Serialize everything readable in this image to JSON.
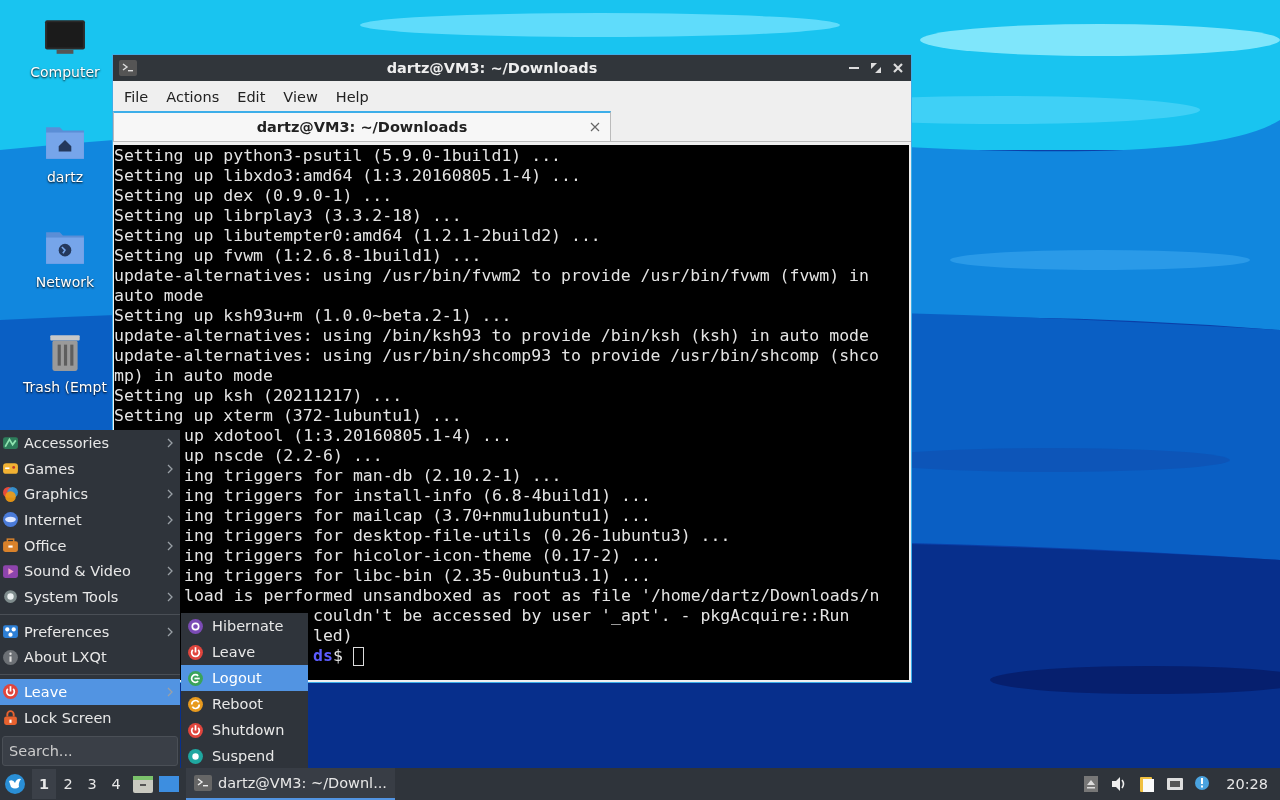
{
  "desktop_icons": [
    {
      "label": "Computer"
    },
    {
      "label": "dartz"
    },
    {
      "label": "Network"
    },
    {
      "label": "Trash (Empt"
    }
  ],
  "window": {
    "title": "dartz@VM3: ~/Downloads",
    "menu": [
      "File",
      "Actions",
      "Edit",
      "View",
      "Help"
    ],
    "tabs": [
      {
        "label": "dartz@VM3: ~/Downloads",
        "selected": true
      }
    ],
    "terminal": {
      "lines": [
        {
          "text": "Setting up python3-psutil (5.9.0-1build1) ...",
          "kind": "plain"
        },
        {
          "text": "Setting up libxdo3:amd64 (1:3.20160805.1-4) ...",
          "kind": "plain"
        },
        {
          "text": "Setting up dex (0.9.0-1) ...",
          "kind": "plain"
        },
        {
          "text": "Setting up librplay3 (3.3.2-18) ...",
          "kind": "plain"
        },
        {
          "text": "Setting up libutempter0:amd64 (1.2.1-2build2) ...",
          "kind": "plain"
        },
        {
          "text": "Setting up fvwm (1:2.6.8-1build1) ...",
          "kind": "plain"
        },
        {
          "text": "update-alternatives: using /usr/bin/fvwm2 to provide /usr/bin/fvwm (fvwm) in",
          "kind": "plain"
        },
        {
          "text": "auto mode",
          "kind": "plain"
        },
        {
          "text": "Setting up ksh93u+m (1.0.0~beta.2-1) ...",
          "kind": "plain"
        },
        {
          "text": "update-alternatives: using /bin/ksh93 to provide /bin/ksh (ksh) in auto mode",
          "kind": "plain"
        },
        {
          "text": "update-alternatives: using /usr/bin/shcomp93 to provide /usr/bin/shcomp (shco",
          "kind": "plain"
        },
        {
          "text": "mp) in auto mode",
          "kind": "plain"
        },
        {
          "text": "Setting up ksh (20211217) ...",
          "kind": "plain"
        },
        {
          "text": "Setting up xterm (372-1ubuntu1) ...",
          "kind": "plain"
        },
        {
          "text": "up xdotool (1:3.20160805.1-4) ...",
          "kind": "undermenu"
        },
        {
          "text": "up nscde (2.2-6) ...",
          "kind": "undermenu"
        },
        {
          "text": "ing triggers for man-db (2.10.2-1) ...",
          "kind": "undermenu"
        },
        {
          "text": "ing triggers for install-info (6.8-4build1) ...",
          "kind": "undermenu"
        },
        {
          "text": "ing triggers for mailcap (3.70+nmu1ubuntu1) ...",
          "kind": "undermenu"
        },
        {
          "text": "ing triggers for desktop-file-utils (0.26-1ubuntu3) ...",
          "kind": "undermenu"
        },
        {
          "text": "ing triggers for hicolor-icon-theme (0.17-2) ...",
          "kind": "undermenu"
        },
        {
          "text": "ing triggers for libc-bin (2.35-0ubuntu3.1) ...",
          "kind": "undermenu"
        },
        {
          "text": "load is performed unsandboxed as root as file '/home/dartz/Downloads/n",
          "kind": "undermenu"
        },
        {
          "text": "couldn't be accessed by user '_apt'. - pkgAcquire::Run",
          "kind": "undersubmenu"
        },
        {
          "text": "led)",
          "kind": "undersubmenu"
        }
      ],
      "prompt": {
        "kind": "undersubmenu",
        "path": "ds",
        "symbol": "$"
      }
    }
  },
  "start_menu": {
    "sections": [
      [
        {
          "label": "Accessories",
          "has_submenu": true,
          "selected": false
        },
        {
          "label": "Games",
          "has_submenu": true,
          "selected": false
        },
        {
          "label": "Graphics",
          "has_submenu": true,
          "selected": false
        },
        {
          "label": "Internet",
          "has_submenu": true,
          "selected": false
        },
        {
          "label": "Office",
          "has_submenu": true,
          "selected": false
        },
        {
          "label": "Sound & Video",
          "has_submenu": true,
          "selected": false
        },
        {
          "label": "System Tools",
          "has_submenu": true,
          "selected": false
        }
      ],
      [
        {
          "label": "Preferences",
          "has_submenu": true,
          "selected": false
        },
        {
          "label": "About LXQt",
          "has_submenu": false,
          "selected": false
        }
      ],
      [
        {
          "label": "Leave",
          "has_submenu": true,
          "selected": true
        },
        {
          "label": "Lock Screen",
          "has_submenu": false,
          "selected": false
        }
      ]
    ],
    "search": {
      "placeholder": "Search..."
    }
  },
  "leave_submenu": {
    "items": [
      {
        "label": "Hibernate",
        "selected": false
      },
      {
        "label": "Leave",
        "selected": false
      },
      {
        "label": "Logout",
        "selected": true
      },
      {
        "label": "Reboot",
        "selected": false
      },
      {
        "label": "Shutdown",
        "selected": false
      },
      {
        "label": "Suspend",
        "selected": false
      }
    ]
  },
  "taskbar": {
    "workspaces": [
      {
        "label": "1",
        "selected": true
      },
      {
        "label": "2",
        "selected": false
      },
      {
        "label": "3",
        "selected": false
      },
      {
        "label": "4",
        "selected": false
      }
    ],
    "tasks": [
      {
        "label": "dartz@VM3: ~/Downl...",
        "selected": true
      }
    ],
    "clock": "20:28"
  }
}
